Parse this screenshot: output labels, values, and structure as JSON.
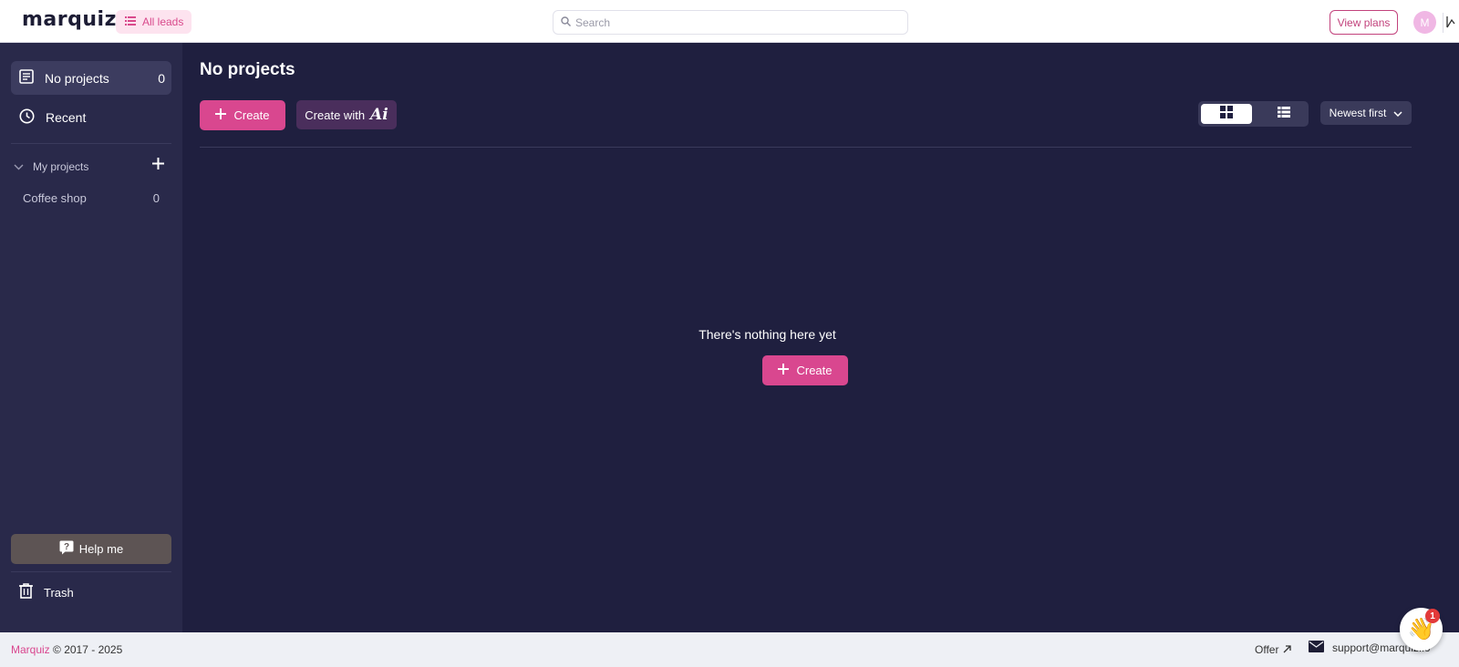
{
  "header": {
    "logo": "marquiz",
    "all_leads_label": "All leads",
    "search_placeholder": "Search",
    "view_plans_label": "View plans",
    "avatar_initial": "M"
  },
  "sidebar": {
    "items": [
      {
        "label": "No projects",
        "count": "0"
      },
      {
        "label": "Recent"
      }
    ],
    "section_label": "My projects",
    "projects": [
      {
        "label": "Coffee shop",
        "count": "0"
      }
    ],
    "help_label": "Help me",
    "trash_label": "Trash"
  },
  "main": {
    "title": "No projects",
    "create_label": "Create",
    "create_with_label": "Create with",
    "ai_mark": "Ai",
    "sort_label": "Newest first",
    "empty_text": "There's nothing here yet",
    "empty_create_label": "Create"
  },
  "footer": {
    "brand": "Marquiz",
    "copyright": "© 2017 - 2025",
    "offer_label": "Offer",
    "support_email": "support@marquiz.io"
  },
  "chat": {
    "badge_count": "1",
    "icon": "waving-hand-icon"
  },
  "colors": {
    "accent": "#d9478f",
    "background": "#1f1f3f",
    "sidebar": "#29294a"
  }
}
